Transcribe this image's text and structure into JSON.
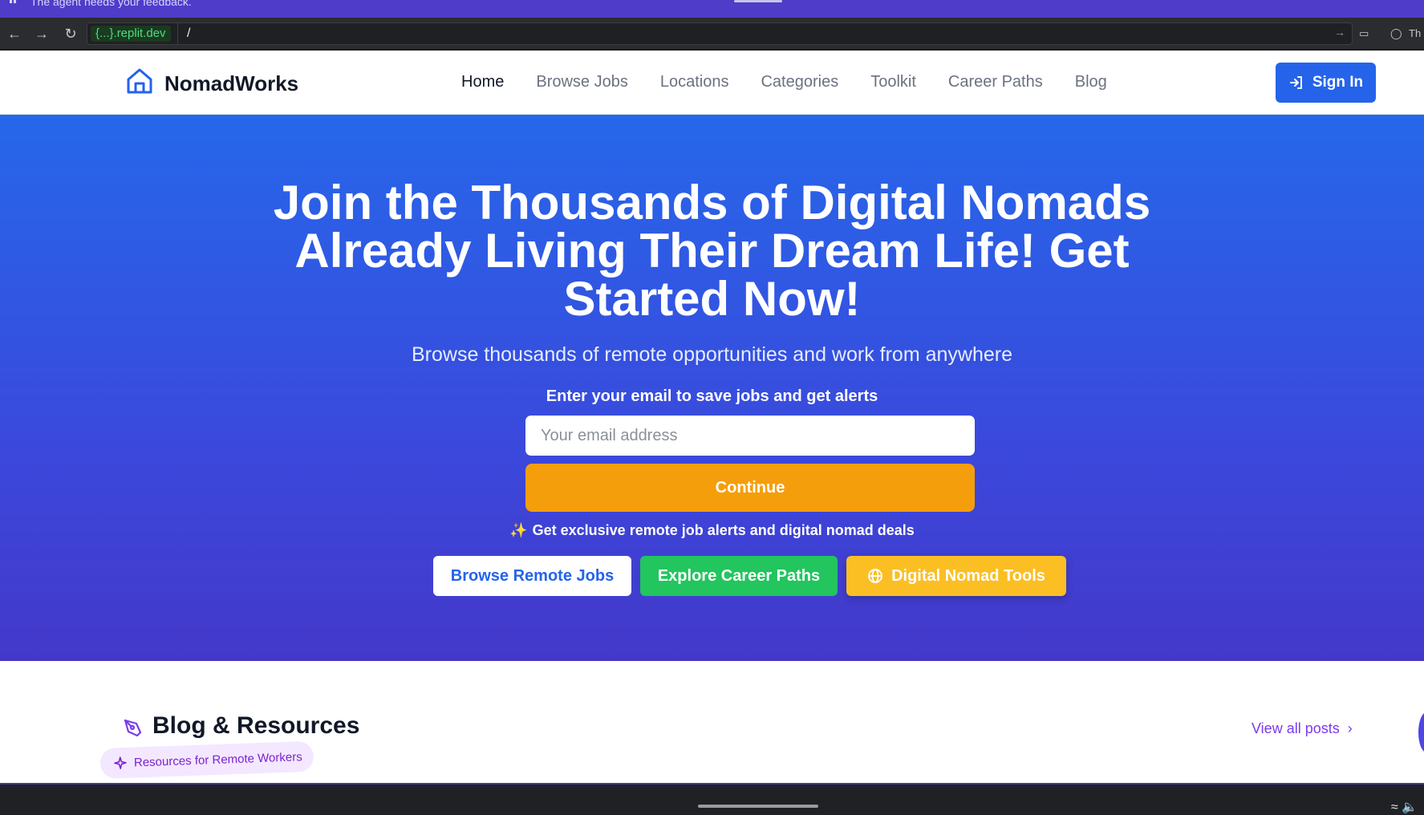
{
  "agent_bar": {
    "text": "The agent needs your feedback."
  },
  "browser": {
    "url_host": "{...}.replit.dev",
    "url_path": "/",
    "right_label": "Th"
  },
  "header": {
    "brand": "NomadWorks",
    "nav": [
      "Home",
      "Browse Jobs",
      "Locations",
      "Categories",
      "Toolkit",
      "Career Paths",
      "Blog"
    ],
    "active_nav": "Home",
    "sign_in": "Sign In"
  },
  "hero": {
    "title": "Join the Thousands of Digital Nomads Already Living Their Dream Life! Get Started Now!",
    "subtitle": "Browse thousands of remote opportunities and work from anywhere",
    "email_label": "Enter your email to save jobs and get alerts",
    "email_placeholder": "Your email address",
    "continue": "Continue",
    "perk": "Get exclusive remote job alerts and digital nomad deals",
    "perk_icon": "✨",
    "cta_browse": "Browse Remote Jobs",
    "cta_career": "Explore Career Paths",
    "cta_tools": "Digital Nomad Tools"
  },
  "blog": {
    "title": "Blog & Resources",
    "view_all": "View all posts",
    "badge": "Resources for Remote Workers"
  },
  "colors": {
    "brand_blue": "#2563eb",
    "accent_orange": "#f59e0b",
    "accent_green": "#22c55e",
    "accent_yellow": "#fbbf24",
    "accent_purple": "#7c3aed"
  }
}
